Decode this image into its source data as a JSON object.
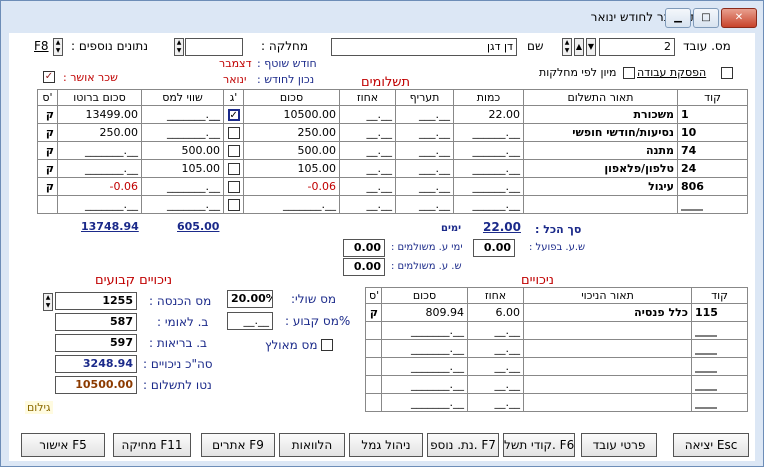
{
  "window": {
    "title": "הכנת השכר לחודש ינואר"
  },
  "header": {
    "employee_no_label": "מס. עובד",
    "employee_no": "2",
    "name_label": "שם",
    "name": "דן דגן",
    "department_label": "מחלקה :",
    "department": "",
    "extra_data_label": "נתונים נוספים :",
    "extra_data_key": "F8",
    "shared_month_label": "חודש שוטף :",
    "shared_month": "דצמבר",
    "correct_month_label": "נכון לחודש :",
    "correct_month": "ינואר",
    "approved_salary_label": "שכר אושר :",
    "approved_salary_checked": "✓",
    "stop_work_label": "הפסקת עבודה",
    "sort_by_dept_label": "מיון לפי מחלקות"
  },
  "payments": {
    "heading": "תשלומים",
    "columns": [
      "קוד",
      "תאור התשלום",
      "כמות",
      "תעריף",
      "אחוז",
      "סכום",
      "ג'",
      "שווי למס",
      "סכום ברוטו",
      "ס'"
    ],
    "rows": [
      {
        "code": "1",
        "desc": "משכורת",
        "qty": "22.00",
        "rate": "___.__",
        "pct": "__.__",
        "amount": "10500.00",
        "g": "✓",
        "tax_value": "_______.__",
        "gross": "13499.00",
        "s": "ק"
      },
      {
        "code": "10",
        "desc": "נסיעות/חודשי חופשי",
        "qty": "______.__",
        "rate": "___.__",
        "pct": "__.__",
        "amount": "250.00",
        "g": "",
        "tax_value": "_______.__",
        "gross": "250.00",
        "s": "ק"
      },
      {
        "code": "74",
        "desc": "מתנה",
        "qty": "______.__",
        "rate": "___.__",
        "pct": "__.__",
        "amount": "500.00",
        "g": "",
        "tax_value": "500.00",
        "gross": "_______.__",
        "s": "ק"
      },
      {
        "code": "24",
        "desc": "טלפון/פלאפון",
        "qty": "______.__",
        "rate": "___.__",
        "pct": "__.__",
        "amount": "105.00",
        "g": "",
        "tax_value": "105.00",
        "gross": "_______.__",
        "s": "ק"
      },
      {
        "code": "806",
        "desc": "עיגול",
        "qty": "______.__",
        "rate": "___.__",
        "pct": "__.__",
        "amount": "-0.06",
        "g": "",
        "tax_value": "_______.__",
        "gross": "-0.06",
        "s": "ק"
      },
      {
        "code": "____",
        "desc": "",
        "qty": "______.__",
        "rate": "___.__",
        "pct": "__.__",
        "amount": "_______.__",
        "g": "",
        "tax_value": "_______.__",
        "gross": "_______.__",
        "s": ""
      }
    ],
    "total_gross": "13748.94",
    "total_tax_value": "605.00"
  },
  "summary": {
    "total_label": "סך הכל :",
    "total_days": "22.00",
    "days_label": "ימים",
    "hours_actual_label": "ש.ע. בפועל :",
    "hours_actual": "0.00",
    "paid_days_label": "ימי ע. משולמים :",
    "paid_days": "0.00",
    "paid_hours_label": "ש. ע. משולמים :",
    "paid_hours": "0.00"
  },
  "deductions": {
    "heading": "ניכויים",
    "columns": [
      "קוד",
      "תאור הניכוי",
      "אחוז",
      "סכום",
      "ס'"
    ],
    "rows": [
      {
        "code": "115",
        "desc": "כלל פנסיה",
        "pct": "6.00",
        "amount": "809.94",
        "s": "ק"
      },
      {
        "code": "____",
        "desc": "",
        "pct": "__.__",
        "amount": "_______.__",
        "s": ""
      },
      {
        "code": "____",
        "desc": "",
        "pct": "__.__",
        "amount": "_______.__",
        "s": ""
      },
      {
        "code": "____",
        "desc": "",
        "pct": "__.__",
        "amount": "_______.__",
        "s": ""
      },
      {
        "code": "____",
        "desc": "",
        "pct": "__.__",
        "amount": "_______.__",
        "s": ""
      },
      {
        "code": "____",
        "desc": "",
        "pct": "__.__",
        "amount": "_______.__",
        "s": ""
      }
    ]
  },
  "fixed": {
    "heading": "ניכויים קבועים",
    "income_tax_label": "מס הכנסה :",
    "income_tax": "1255",
    "national_ins_label": "ב. לאומי :",
    "national_ins": "587",
    "health_ins_label": "ב. בריאות :",
    "health_ins": "597",
    "total_ded_label": "סה\"כ ניכויים :",
    "total_ded": "3248.94",
    "net_label": "נטו לתשלום :",
    "net": "10500.00",
    "marginal_tax_label": "מס שולי:",
    "marginal_tax": "20.00%",
    "fixed_tax_label": "%מס קבוע :",
    "fixed_tax": "__.__",
    "recommended_tax_label": "מס מאולץ",
    "status": "גילום"
  },
  "buttons": {
    "exit": "יציאה Esc",
    "employee_details": "פרטי עובד",
    "payment_codes": "קודי תשל. F6",
    "extra_data": "נת. נוספ. F7",
    "fund_mgmt": "ניהול גמל",
    "loans": "הלוואות",
    "sites": "אתרים F9",
    "delete": "מחיקה F11",
    "approve": "אישור F5"
  },
  "colors": {
    "accent": "#c00000",
    "navy": "#1b2a8a",
    "window_bg": "#dce7f5",
    "net_value": "#8b3a00"
  }
}
